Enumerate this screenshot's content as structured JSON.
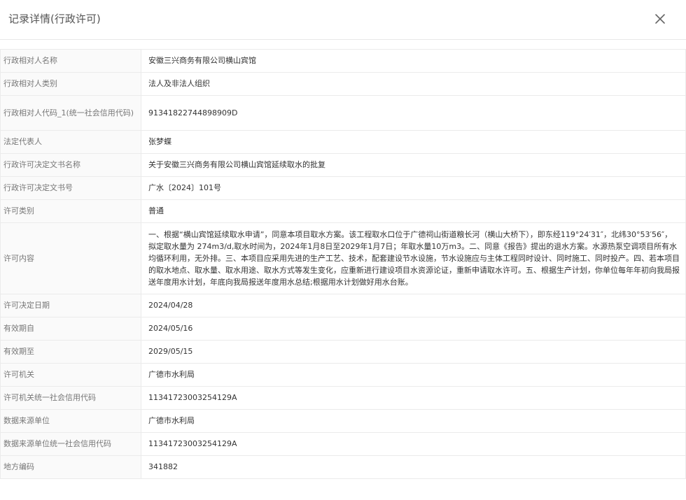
{
  "dialog": {
    "title": "记录详情(行政许可)",
    "close_icon": "close-icon"
  },
  "rows": [
    {
      "label": "行政相对人名称",
      "value": "安徽三兴商务有限公司横山宾馆"
    },
    {
      "label": "行政相对人类别",
      "value": "法人及非法人组织"
    },
    {
      "label": "行政相对人代码_1(统一社会信用代码)",
      "value": "91341822744898909D"
    },
    {
      "label": "法定代表人",
      "value": "张梦蝶"
    },
    {
      "label": "行政许可决定文书名称",
      "value": "关于安徽三兴商务有限公司横山宾馆延续取水的批复"
    },
    {
      "label": "行政许可决定文书号",
      "value": "广水〔2024〕101号"
    },
    {
      "label": "许可类别",
      "value": "普通"
    },
    {
      "label": "许可内容",
      "value": "一、根据“横山宾馆延续取水申请”，同意本项目取水方案。该工程取水口位于广德祠山街道粮长河（横山大桥下），即东经119°24′31″，北纬30°53′56″，拟定取水量为 274m3/d,取水时间为，2024年1月8日至2029年1月7日；年取水量10万m3。二、同意《报告》提出的退水方案。水源热泵空调项目所有水均循环利用，无外排。三、本项目应采用先进的生产工艺、技术，配套建设节水设施，节水设施应与主体工程同时设计、同时施工、同时投产。四、若本项目的取水地点、取水量、取水用途、取水方式等发生变化，应重新进行建设项目水资源论证，重新申请取水许可。五、根据生产计划，你单位每年年初向我局报送年度用水计划，年底向我局报送年度用水总结;根据用水计划做好用水台账。"
    },
    {
      "label": "许可决定日期",
      "value": "2024/04/28"
    },
    {
      "label": "有效期自",
      "value": "2024/05/16"
    },
    {
      "label": "有效期至",
      "value": "2029/05/15"
    },
    {
      "label": "许可机关",
      "value": "广德市水利局"
    },
    {
      "label": "许可机关统一社会信用代码",
      "value": "11341723003254129A"
    },
    {
      "label": "数据来源单位",
      "value": "广德市水利局"
    },
    {
      "label": "数据来源单位统一社会信用代码",
      "value": "11341723003254129A"
    },
    {
      "label": "地方编码",
      "value": "341882"
    }
  ]
}
